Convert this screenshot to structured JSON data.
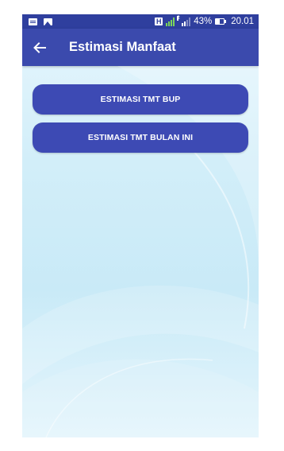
{
  "status_bar": {
    "network_badge": "H",
    "sim2_label": "2",
    "battery_percent": "43%",
    "time": "20.01"
  },
  "app_bar": {
    "title": "Estimasi Manfaat",
    "back_icon": "arrow-left-icon"
  },
  "menu": {
    "buttons": [
      {
        "label": "ESTIMASI TMT BUP"
      },
      {
        "label": "ESTIMASI TMT BULAN INI"
      }
    ]
  },
  "colors": {
    "status_bar": "#2f3f9e",
    "app_bar": "#3b4aad",
    "button": "#3d4ab4",
    "background": "#d2eef9"
  }
}
